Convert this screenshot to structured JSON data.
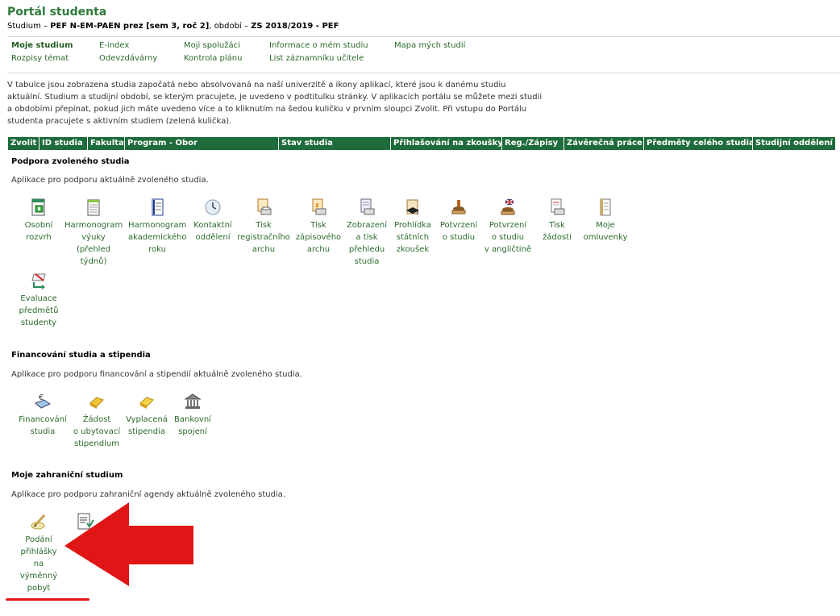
{
  "header": {
    "title": "Portál studenta",
    "subtitle_prefix": "Studium – ",
    "study": "PEF N-EM-PAEN prez [sem 3, roč 2]",
    "period_label": ", období – ",
    "period": "ZS 2018/2019 - PEF"
  },
  "nav": {
    "moje_studium": "Moje studium",
    "eindex": "E-index",
    "spoluzaci": "Moji spolužáci",
    "informace": "Informace o mém studiu",
    "mapa": "Mapa mých studií",
    "rozpisy": "Rozpisy témat",
    "odevzdavarny": "Odevzdávárny",
    "kontrola": "Kontrola plánu",
    "list": "List záznamníku učitele"
  },
  "intro": "V tabulce jsou zobrazena studia započatá nebo absolvovaná na naší univerzitě a ikony aplikací, které jsou k danému studiu aktuální. Studium a studijní období, se kterým pracujete, je uvedeno v podtitulku stránky. V aplikacích portálu se můžete mezi studii a obdobími přepínat, pokud jich máte uvedeno více a to kliknutím na šedou kuličku v prvním sloupci Zvolit. Při vstupu do Portálu studenta pracujete s aktivním studiem (zelená kulička).",
  "table_headers": [
    "Zvolit",
    "ID studia",
    "Fakulta",
    "Program - Obor",
    "Stav studia",
    "Přihlašování na zkoušky",
    "Reg./Zápisy",
    "Závěrečná práce",
    "Předměty celého studia",
    "Studijní oddělení"
  ],
  "sections": {
    "podpora": {
      "title": "Podpora zvoleného studia",
      "desc": "Aplikace pro podporu aktuálně zvoleného studia.",
      "apps": [
        {
          "label": "Osobní\nrozvrh",
          "icon": "timetable-icon"
        },
        {
          "label": "Harmonogram\nvýuky\n(přehled\ntýdnů)",
          "icon": "schedule-icon"
        },
        {
          "label": "Harmonogram\nakademického\nroku",
          "icon": "calendar-icon"
        },
        {
          "label": "Kontaktní\noddělení",
          "icon": "clock-icon"
        },
        {
          "label": "Tisk\nregistračního\narchu",
          "icon": "print-icon"
        },
        {
          "label": "Tisk\nzápisového\narchu",
          "icon": "print-icon"
        },
        {
          "label": "Zobrazení\na tisk\npřehledu\nstudia",
          "icon": "print-overview-icon"
        },
        {
          "label": "Prohlídka\nstátních\nzkoušek",
          "icon": "graduation-icon"
        },
        {
          "label": "Potvrzení\no studiu",
          "icon": "stamp-icon"
        },
        {
          "label": "Potvrzení\no studiu\nv angličtině",
          "icon": "stamp-english-icon"
        },
        {
          "label": "Tisk\nžádosti",
          "icon": "print-request-icon"
        },
        {
          "label": "Moje\nomluvenky",
          "icon": "excuse-icon"
        },
        {
          "label": "Evaluace\npředmětů\nstudenty",
          "icon": "evaluation-icon"
        }
      ]
    },
    "financovani": {
      "title": "Financování studia a stipendia",
      "desc": "Aplikace pro podporu financování a stipendií aktuálně zvoleného studia.",
      "apps": [
        {
          "label": "Financování\nstudia",
          "icon": "finance-icon"
        },
        {
          "label": "Žádost\no ubytovací\nstipendium",
          "icon": "gold-bar-icon"
        },
        {
          "label": "Vyplacená\nstipendia",
          "icon": "gold-bar-icon"
        },
        {
          "label": "Bankovní\nspojení",
          "icon": "bank-icon"
        }
      ]
    },
    "zahranicni": {
      "title": "Moje zahraniční studium",
      "desc": "Aplikace pro podporu zahraniční agendy aktuálně zvoleného studia.",
      "apps": [
        {
          "label": "Podání\npřihlášky\nna\nvýměnný\npobyt",
          "icon": "application-pen-icon"
        },
        {
          "label": "",
          "icon": "document-check-icon"
        }
      ]
    }
  },
  "colors": {
    "brand_green": "#2f7a3a",
    "header_bar": "#1e6b3b",
    "annotation_red": "#e01616"
  }
}
